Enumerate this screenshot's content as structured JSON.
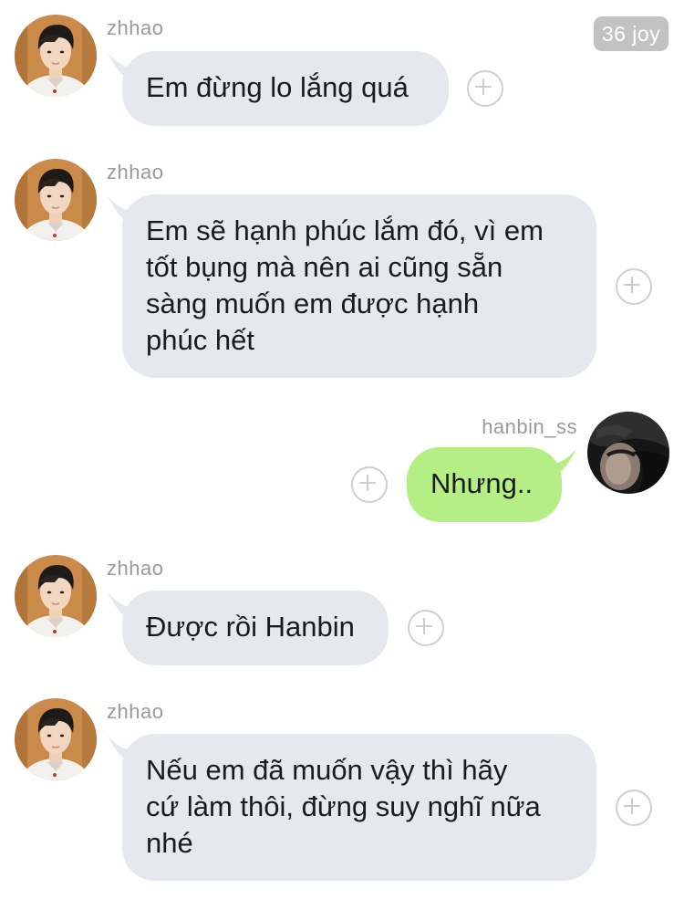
{
  "watermark": "36 joy",
  "messages": [
    {
      "sender": "zhhao",
      "text": "Em đừng lo lắng quá"
    },
    {
      "sender": "zhhao",
      "lines": [
        "Em sẽ hạnh phúc lắm đó, vì em",
        "tốt bụng mà nên ai cũng sẵn",
        "sàng muốn em được hạnh",
        "phúc hết"
      ]
    },
    {
      "sender": "hanbin_ss",
      "text": "Nhưng.."
    },
    {
      "sender": "zhhao",
      "text": "Được rồi Hanbin"
    },
    {
      "sender": "zhhao",
      "lines": [
        "Nếu em đã muốn vậy thì hãy",
        "cứ làm thôi, đừng suy nghĩ nữa",
        "nhé"
      ]
    }
  ],
  "colors": {
    "incoming_bubble": "#e5e8ed",
    "outgoing_bubble": "#b6ee86",
    "sender_name": "#9a9a9a",
    "watermark_bg": "#c2c2c2"
  },
  "icons": {
    "react": "add-reaction-icon"
  }
}
